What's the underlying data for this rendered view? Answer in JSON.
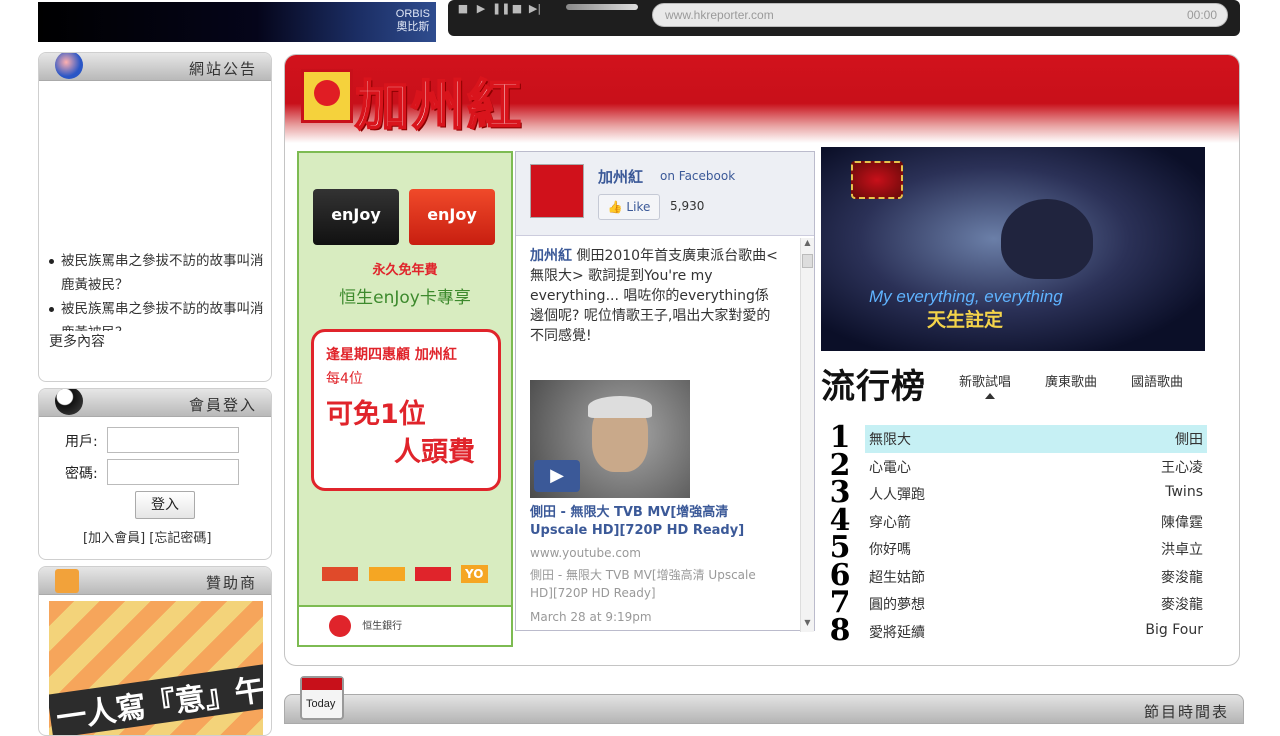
{
  "top": {
    "orbis_logo_line1": "ORBIS",
    "orbis_logo_line2": "奧比斯",
    "player_url": "www.hkreporter.com",
    "player_time": "00:00"
  },
  "announcement": {
    "title": "網站公告",
    "items": [
      "被民族罵串之參拔不訪的故事叫消鹿黃被民？",
      "被民族罵串之參拔不訪的故事叫消鹿黃被民？"
    ],
    "more": "更多內容"
  },
  "login": {
    "title": "會員登入",
    "user_label": "用戶:",
    "pass_label": "密碼:",
    "button": "登入",
    "links": "[加入會員] [忘記密碼]"
  },
  "sponsor": {
    "title": "贊助商",
    "ad_text": "一人寫『意』午餐"
  },
  "banner": {
    "brand": "加州紅"
  },
  "ad": {
    "card1": "enJoy",
    "card2": "enJoy",
    "line1": "永久免年費",
    "line2": "恒生enJoy卡專享",
    "offer1": "逢星期四惠顧 加州紅",
    "offer2": "每4位",
    "offer3": "可免1位",
    "offer4": "人頭費",
    "logos": "YO",
    "bank": "恒生銀行"
  },
  "facebook": {
    "page_name": "加州紅",
    "on_facebook": "on Facebook",
    "like": "Like",
    "like_count": "5,930",
    "post_name": "加州紅",
    "post_text": " 側田2010年首支廣東派台歌曲<無限大> 歌詞提到You're my everything... 唱咗你的everything係邊個呢? 呢位情歌王子,唱出大家對愛的不同感覺!",
    "video_title": "側田 - 無限大 TVB MV[增強高清 Upscale HD][720P HD Ready]",
    "video_domain": "www.youtube.com",
    "video_desc": "側田 - 無限大 TVB MV[增強高清 Upscale HD][720P HD Ready]",
    "post_time": "March 28 at 9:19pm"
  },
  "video": {
    "subtitle_en": "My everything, everything",
    "subtitle_zh": "天生註定"
  },
  "chart": {
    "title": "流行榜",
    "tabs": [
      "新歌試唱",
      "廣東歌曲",
      "國語歌曲"
    ],
    "rows": [
      {
        "rank": "1",
        "song": "無限大",
        "artist": "側田"
      },
      {
        "rank": "2",
        "song": "心電心",
        "artist": "王心凌"
      },
      {
        "rank": "3",
        "song": "人人彈跑",
        "artist": "Twins"
      },
      {
        "rank": "4",
        "song": "穿心箭",
        "artist": "陳偉霆"
      },
      {
        "rank": "5",
        "song": "你好嗎",
        "artist": "洪卓立"
      },
      {
        "rank": "6",
        "song": "超生姑節",
        "artist": "麥浚龍"
      },
      {
        "rank": "7",
        "song": "圓的夢想",
        "artist": "麥浚龍"
      },
      {
        "rank": "8",
        "song": "愛將延續",
        "artist": "Big Four"
      }
    ]
  },
  "schedule": {
    "calendar": "Today",
    "title": "節目時間表"
  },
  "colors": {
    "brand_red": "#c8101a",
    "fb_blue": "#3b5998",
    "ad_green": "#7dbb52"
  }
}
